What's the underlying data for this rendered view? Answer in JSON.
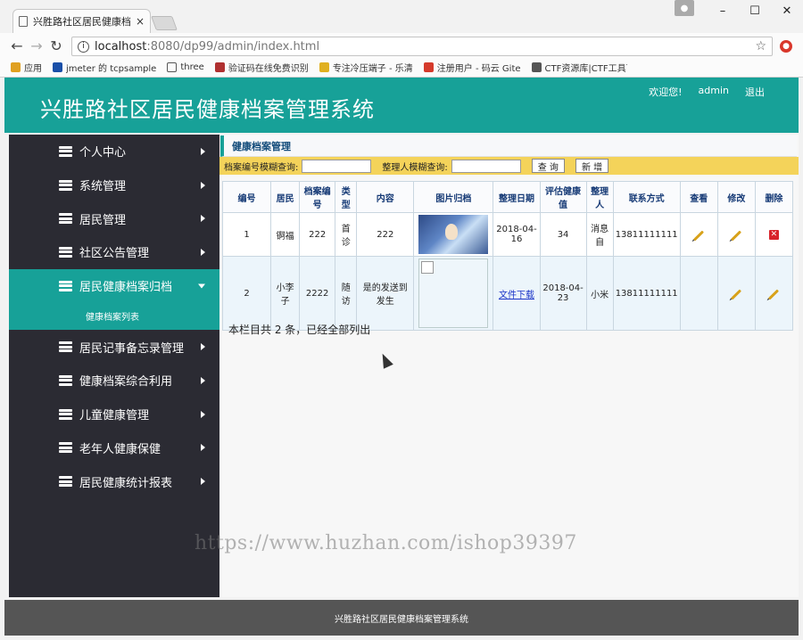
{
  "browser": {
    "tab_title": "兴胜路社区居民健康档案",
    "tab_close": "×",
    "url_host": "localhost",
    "url_path": ":8080/dp99/admin/index.html",
    "bookmarks": [
      {
        "label": "应用",
        "color": "#e0a020"
      },
      {
        "label": "jmeter 的 tcpsample",
        "color": "#1a4fa8"
      },
      {
        "label": "three",
        "color": "#ffffff"
      },
      {
        "label": "验证码在线免费识别",
        "color": "#b03030"
      },
      {
        "label": "专注冷压端子 - 乐清",
        "color": "#e0b020"
      },
      {
        "label": "注册用户 - 码云 Gite",
        "color": "#d53a2b"
      },
      {
        "label": "CTF资源库|CTF工具下",
        "color": "#555555"
      }
    ],
    "window_controls": {
      "minimize": "–",
      "maximize": "☐",
      "close": "✕"
    }
  },
  "header": {
    "title": "兴胜路社区居民健康档案管理系统",
    "welcome": "欢迎您!",
    "user": "admin",
    "logout": "退出"
  },
  "sidebar": {
    "items": [
      {
        "label": "个人中心"
      },
      {
        "label": "系统管理"
      },
      {
        "label": "居民管理"
      },
      {
        "label": "社区公告管理"
      },
      {
        "label": "居民健康档案归档"
      },
      {
        "label": "居民记事备忘录管理"
      },
      {
        "label": "健康档案综合利用"
      },
      {
        "label": "儿童健康管理"
      },
      {
        "label": "老年人健康保健"
      },
      {
        "label": "居民健康统计报表"
      }
    ],
    "active_index": 4,
    "submenu_label": "健康档案列表"
  },
  "main": {
    "section_title": "健康档案管理",
    "search": {
      "label1": "档案编号模糊查询:",
      "label2": "整理人模糊查询:",
      "query_button": "查 询",
      "add_button": "新 增"
    },
    "table": {
      "headers": [
        "编号",
        "居民",
        "档案编号",
        "类型",
        "内容",
        "图片归档",
        "整理日期",
        "评估健康值",
        "整理人",
        "联系方式",
        "查看",
        "修改",
        "删除"
      ],
      "rows": [
        {
          "id": "1",
          "resident": "锕福",
          "file_no": "222",
          "type": "首诊",
          "content": "222",
          "file_text": "",
          "date": "2018-04-16",
          "health": "34",
          "organizer": "消息自",
          "phone": "13811111111"
        },
        {
          "id": "2",
          "resident": "小李子",
          "file_no": "2222",
          "type": "随访",
          "content": "是的发送到发生",
          "file_text": "文件下载",
          "date": "2018-04-23",
          "health": "",
          "organizer": "小米",
          "phone": "13811111111"
        }
      ]
    },
    "summary": "本栏目共 2 条，已经全部列出"
  },
  "watermark": "https://www.huzhan.com/ishop39397",
  "footer": "兴胜路社区居民健康档案管理系统",
  "colors": {
    "accent": "#17a198",
    "sidebar": "#2b2b33",
    "search_bar": "#f4d35a",
    "footer": "#555555"
  }
}
